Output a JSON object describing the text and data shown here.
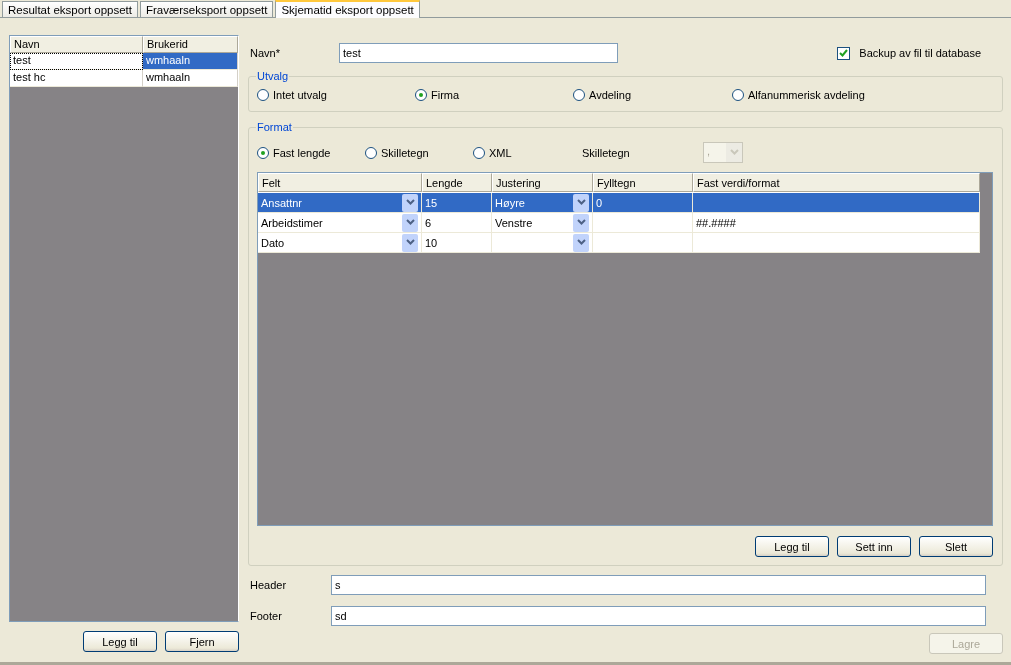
{
  "tabs": [
    {
      "label": "Resultat eksport oppsett",
      "selected": false
    },
    {
      "label": "Fraværseksport oppsett",
      "selected": false
    },
    {
      "label": "Skjematid eksport oppsett",
      "selected": true
    }
  ],
  "list": {
    "columns": [
      "Navn",
      "Brukerid"
    ],
    "rows": [
      {
        "cells": [
          "test",
          "wmhaaln"
        ],
        "selected": true
      },
      {
        "cells": [
          "test hc",
          "wmhaaln"
        ],
        "selected": false
      }
    ],
    "buttons": [
      "Legg til",
      "Fjern"
    ]
  },
  "name_field": {
    "label": "Navn*",
    "value": "test"
  },
  "backup": {
    "label": "Backup av fil til database",
    "checked": true
  },
  "utvalg": {
    "title": "Utvalg",
    "options": [
      {
        "label": "Intet utvalg",
        "selected": false
      },
      {
        "label": "Firma",
        "selected": true
      },
      {
        "label": "Avdeling",
        "selected": false
      },
      {
        "label": "Alfanummerisk avdeling",
        "selected": false
      }
    ]
  },
  "format": {
    "title": "Format",
    "options": [
      {
        "label": "Fast lengde",
        "selected": true
      },
      {
        "label": "Skilletegn",
        "selected": false
      },
      {
        "label": "XML",
        "selected": false
      }
    ],
    "separator": {
      "label": "Skilletegn",
      "value": ",",
      "disabled": true
    },
    "grid": {
      "columns": [
        "Felt",
        "Lengde",
        "Justering",
        "Fylltegn",
        "Fast verdi/format"
      ],
      "rows": [
        {
          "cells": [
            "Ansattnr",
            "15",
            "Høyre",
            "0",
            ""
          ],
          "selected": true
        },
        {
          "cells": [
            "Arbeidstimer",
            "6",
            "Venstre",
            "",
            "##.####"
          ],
          "selected": false
        },
        {
          "cells": [
            "Dato",
            "10",
            "",
            "",
            ""
          ],
          "selected": false
        }
      ]
    },
    "buttons": [
      "Legg til",
      "Sett inn",
      "Slett"
    ]
  },
  "header_field": {
    "label": "Header",
    "value": "s"
  },
  "footer_field": {
    "label": "Footer",
    "value": "sd"
  },
  "save_button": {
    "label": "Lagre",
    "disabled": true
  }
}
